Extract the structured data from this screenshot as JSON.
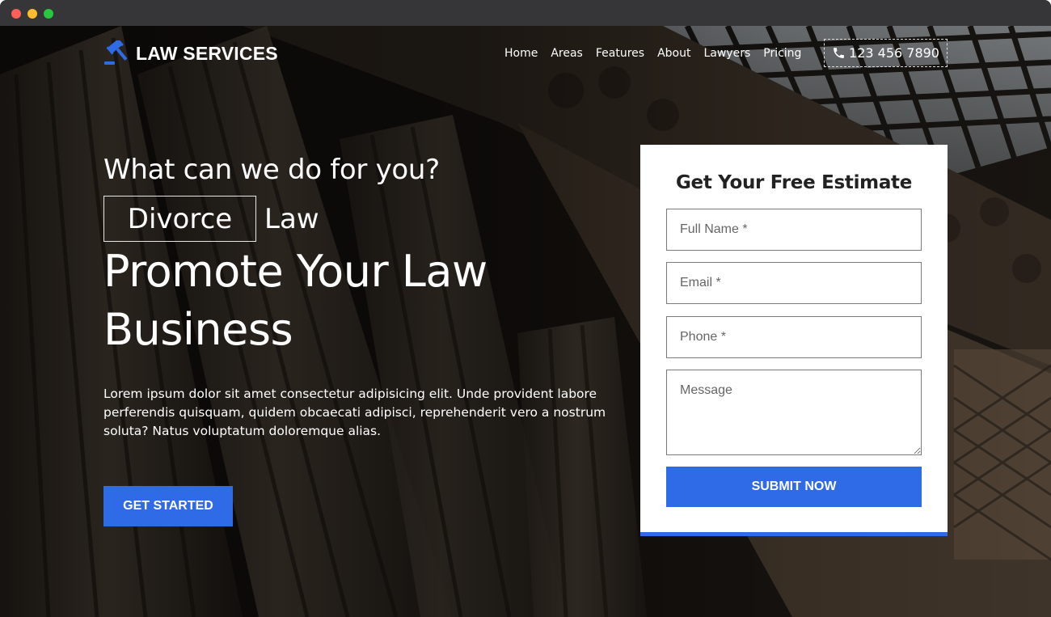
{
  "brand": {
    "name": "LAW SERVICES",
    "icon": "gavel-icon",
    "accent": "#2f6be6"
  },
  "nav": {
    "items": [
      "Home",
      "Areas",
      "Features",
      "About",
      "Lawyers",
      "Pricing"
    ],
    "phone": {
      "icon": "phone-icon",
      "number": "123 456 7890"
    }
  },
  "hero": {
    "tagline": "What can we do for you?",
    "typed_word": "Divorce",
    "typed_suffix": "Law",
    "headline": "Promote Your Law Business",
    "lede": "Lorem ipsum dolor sit amet consectetur adipisicing elit. Unde provident labore perferendis quisquam, quidem obcaecati adipisci, reprehenderit vero a nostrum soluta? Natus voluptatum doloremque alias.",
    "cta_label": "GET STARTED"
  },
  "form": {
    "title": "Get Your Free Estimate",
    "name_placeholder": "Full Name *",
    "email_placeholder": "Email *",
    "phone_placeholder": "Phone *",
    "message_placeholder": "Message",
    "submit_label": "SUBMIT NOW"
  }
}
